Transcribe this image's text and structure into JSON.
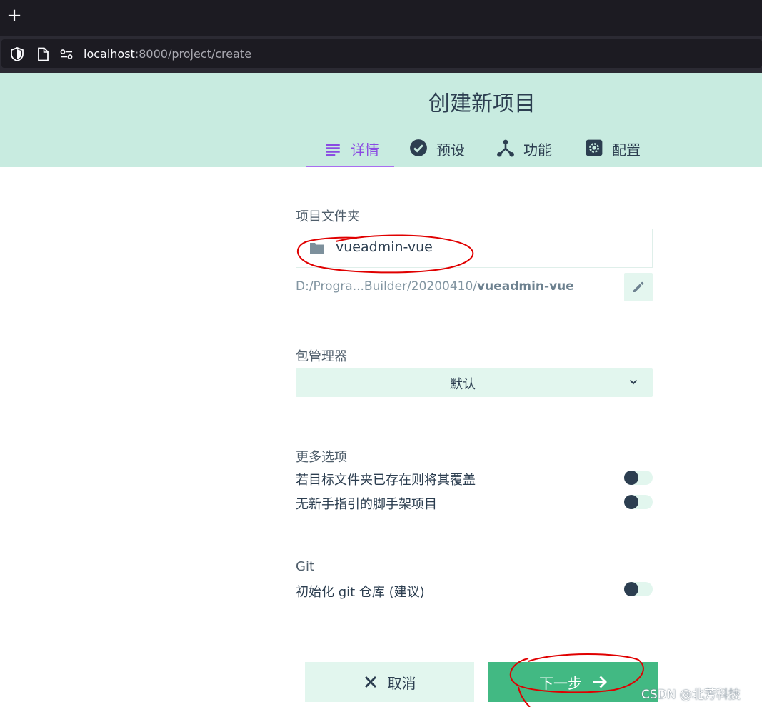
{
  "browser": {
    "new_tab_glyph": "+",
    "url_host": "localhost",
    "url_rest": ":8000/project/create",
    "icons": [
      "shield-icon",
      "page-icon",
      "site-permissions-icon"
    ]
  },
  "header": {
    "title": "创建新项目",
    "tabs": [
      {
        "label": "详情",
        "icon": "list-icon",
        "active": true
      },
      {
        "label": "预设",
        "icon": "check-circle-icon",
        "active": false
      },
      {
        "label": "功能",
        "icon": "fork-icon",
        "active": false
      },
      {
        "label": "配置",
        "icon": "gear-icon",
        "active": false
      }
    ]
  },
  "form": {
    "folder": {
      "label": "项目文件夹",
      "value": "vueadmin-vue",
      "path_prefix": "D:/Progra...Builder/20200410/",
      "path_name": "vueadmin-vue"
    },
    "package_manager": {
      "label": "包管理器",
      "selected": "默认"
    },
    "more_options": {
      "label": "更多选项",
      "items": [
        {
          "label": "若目标文件夹已存在则将其覆盖",
          "enabled": false
        },
        {
          "label": "无新手指引的脚手架项目",
          "enabled": false
        }
      ]
    },
    "git": {
      "label": "Git",
      "items": [
        {
          "label": "初始化 git 仓库 (建议)",
          "enabled": false
        }
      ]
    }
  },
  "footer": {
    "cancel_label": "取消",
    "next_label": "下一步"
  },
  "colors": {
    "accent": "#42b983",
    "header_bg": "#c8ebe0",
    "active_tab": "#8a4be2",
    "annotation": "#e00000"
  },
  "watermark": "CSDN @北芳科技"
}
